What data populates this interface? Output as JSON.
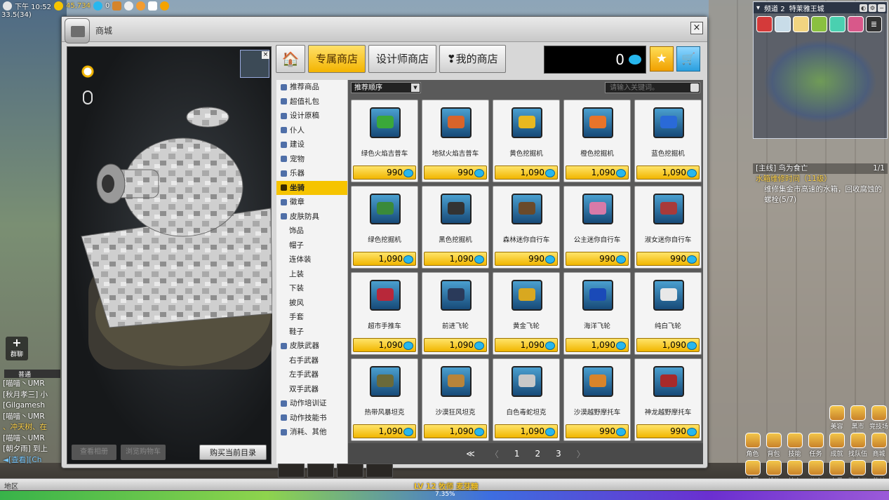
{
  "topbar": {
    "time": "下午 10:52",
    "coins": "45,734",
    "zero": "0",
    "fps": "33.5(34)"
  },
  "minimap": {
    "channel": "频道 2",
    "city": "特莱雅王城"
  },
  "quest": {
    "title": "[主线] 鸟为食亡",
    "progress": "1/1",
    "subtitle": "水箱维修时间（11级）",
    "desc": "维修集金市高速的水箱，回收腐蚀的螺栓(5/7)"
  },
  "shop": {
    "title": "商城",
    "close": "×",
    "tabs": {
      "home_icon": "🏠",
      "exclusive": "专属商店",
      "designer": "设计师商店",
      "mine": "❣我的商店"
    },
    "balance": "0",
    "preview": {
      "btn1": "查看相册",
      "btn2": "浏览购物车",
      "buy": "购买当前目录"
    },
    "categories": [
      {
        "label": "推荐商品",
        "sub": false,
        "active": false
      },
      {
        "label": "超值礼包",
        "sub": false,
        "active": false
      },
      {
        "label": "设计原稿",
        "sub": false,
        "active": false
      },
      {
        "label": "仆人",
        "sub": false,
        "active": false
      },
      {
        "label": "建设",
        "sub": false,
        "active": false
      },
      {
        "label": "宠物",
        "sub": false,
        "active": false
      },
      {
        "label": "乐器",
        "sub": false,
        "active": false
      },
      {
        "label": "坐骑",
        "sub": false,
        "active": true
      },
      {
        "label": "徽章",
        "sub": false,
        "active": false
      },
      {
        "label": "皮肤防具",
        "sub": false,
        "active": false
      },
      {
        "label": "饰品",
        "sub": true,
        "active": false
      },
      {
        "label": "帽子",
        "sub": true,
        "active": false
      },
      {
        "label": "连体装",
        "sub": true,
        "active": false
      },
      {
        "label": "上装",
        "sub": true,
        "active": false
      },
      {
        "label": "下装",
        "sub": true,
        "active": false
      },
      {
        "label": "披风",
        "sub": true,
        "active": false
      },
      {
        "label": "手套",
        "sub": true,
        "active": false
      },
      {
        "label": "鞋子",
        "sub": true,
        "active": false
      },
      {
        "label": "皮肤武器",
        "sub": false,
        "active": false
      },
      {
        "label": "右手武器",
        "sub": true,
        "active": false
      },
      {
        "label": "左手武器",
        "sub": true,
        "active": false
      },
      {
        "label": "双手武器",
        "sub": true,
        "active": false
      },
      {
        "label": "动作培训证",
        "sub": false,
        "active": false
      },
      {
        "label": "动作技能书",
        "sub": false,
        "active": false
      },
      {
        "label": "消耗、其他",
        "sub": false,
        "active": false
      }
    ],
    "sort": "推荐顺序",
    "search_placeholder": "请输入关键词。",
    "products": [
      {
        "name": "绿色火焰吉普车",
        "price": "990",
        "color": "#3aa83a"
      },
      {
        "name": "地狱火焰吉普车",
        "price": "990",
        "color": "#d8642a"
      },
      {
        "name": "黄色挖掘机",
        "price": "1,090",
        "color": "#e8b820"
      },
      {
        "name": "橙色挖掘机",
        "price": "1,090",
        "color": "#e8742a"
      },
      {
        "name": "蓝色挖掘机",
        "price": "1,090",
        "color": "#2a6ad8"
      },
      {
        "name": "绿色挖掘机",
        "price": "1,090",
        "color": "#3a8a3a"
      },
      {
        "name": "黑色挖掘机",
        "price": "1,090",
        "color": "#333333"
      },
      {
        "name": "森林迷你自行车",
        "price": "990",
        "color": "#6a4a2a"
      },
      {
        "name": "公主迷你自行车",
        "price": "990",
        "color": "#d87aa8"
      },
      {
        "name": "淑女迷你自行车",
        "price": "990",
        "color": "#a83a3a"
      },
      {
        "name": "超市手推车",
        "price": "1,090",
        "color": "#b8283a"
      },
      {
        "name": "前进飞轮",
        "price": "1,090",
        "color": "#2a3a5a"
      },
      {
        "name": "黄金飞轮",
        "price": "1,090",
        "color": "#d8a820"
      },
      {
        "name": "海洋飞轮",
        "price": "1,090",
        "color": "#1a4ab8"
      },
      {
        "name": "纯白飞轮",
        "price": "1,090",
        "color": "#e8e8e8"
      },
      {
        "name": "热带风暴坦克",
        "price": "1,090",
        "color": "#6a6a3a"
      },
      {
        "name": "沙漠狂风坦克",
        "price": "1,090",
        "color": "#b8843a"
      },
      {
        "name": "白色毒蛇坦克",
        "price": "1,090",
        "color": "#c8c8c8"
      },
      {
        "name": "沙漠越野摩托车",
        "price": "990",
        "color": "#d8842a"
      },
      {
        "name": "神龙越野摩托车",
        "price": "990",
        "color": "#a82a2a"
      }
    ],
    "pager": {
      "first": "≪",
      "prev": "〈",
      "p1": "1",
      "p2": "2",
      "p3": "3",
      "next": "〉"
    }
  },
  "chat": {
    "tab": "普通",
    "lines": [
      {
        "text": "[喵喵丶UMR",
        "cls": ""
      },
      {
        "text": "[秋月孝三] 小",
        "cls": ""
      },
      {
        "text": "[Gilgamesh",
        "cls": ""
      },
      {
        "text": "[喵喵丶UMR",
        "cls": ""
      },
      {
        "text": "、冲天树、在",
        "cls": "yl"
      },
      {
        "text": "[喵喵丶UMR",
        "cls": ""
      },
      {
        "text": "[朝夕雨] 到上",
        "cls": ""
      },
      {
        "text": "◄[查看][Ch",
        "cls": "bl"
      }
    ],
    "add_group_plus": "+",
    "add_group": "群聊"
  },
  "hud": {
    "area": "地区",
    "level": "LV 12 牧师 麦芽糖",
    "exp": "7.35%"
  },
  "menu": {
    "row1": [
      "美容",
      "黑市",
      "竞技场"
    ],
    "row2": [
      "角色",
      "背包",
      "技能",
      "任务",
      "成就",
      "找队伍",
      "商城"
    ],
    "row3": [
      "地图",
      "邮件",
      "社交",
      "公会",
      "向导",
      "游戏厅",
      "菜单"
    ]
  }
}
